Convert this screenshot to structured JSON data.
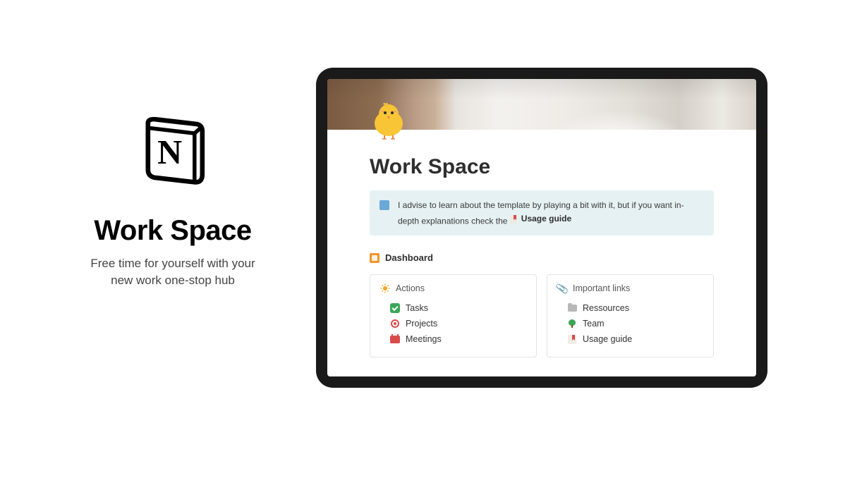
{
  "left": {
    "title": "Work Space",
    "subtitle_line1": "Free time for yourself with your",
    "subtitle_line2": "new work one-stop hub"
  },
  "page": {
    "title": "Work Space",
    "icon_name": "chick-icon"
  },
  "callout": {
    "icon_name": "blue-square-icon",
    "text_before": "I advise to learn about the template by playing a bit with it, but if you want in-depth explanations check the ",
    "link_label": "Usage guide",
    "link_icon_name": "bookmark-icon"
  },
  "dashboard": {
    "label": "Dashboard",
    "icon_name": "orange-square-icon"
  },
  "cards": [
    {
      "header": {
        "label": "Actions",
        "icon_name": "sun-icon"
      },
      "items": [
        {
          "label": "Tasks",
          "icon_name": "check-icon"
        },
        {
          "label": "Projects",
          "icon_name": "target-icon"
        },
        {
          "label": "Meetings",
          "icon_name": "calendar-icon"
        }
      ]
    },
    {
      "header": {
        "label": "Important links",
        "icon_name": "paperclip-icon"
      },
      "items": [
        {
          "label": "Ressources",
          "icon_name": "folder-icon"
        },
        {
          "label": "Team",
          "icon_name": "tree-icon"
        },
        {
          "label": "Usage guide",
          "icon_name": "bookmark-icon"
        }
      ]
    }
  ]
}
